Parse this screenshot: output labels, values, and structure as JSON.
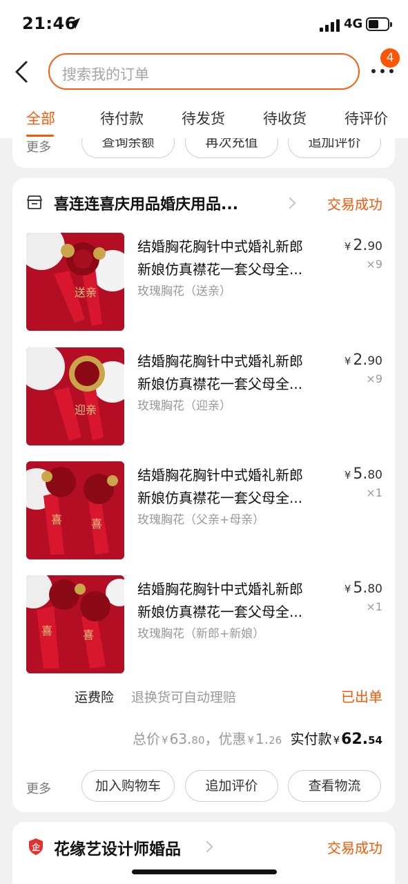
{
  "status_bar": {
    "time": "21:46",
    "network": "4G"
  },
  "header": {
    "search_placeholder": "搜索我的订单",
    "badge_count": "4",
    "tabs": [
      {
        "label": "全部",
        "active": true
      },
      {
        "label": "待付款"
      },
      {
        "label": "待发货"
      },
      {
        "label": "待收货"
      },
      {
        "label": "待评价"
      }
    ]
  },
  "prev_order": {
    "more_label": "更多",
    "actions": [
      "查询余额",
      "再次充值",
      "追加评价"
    ]
  },
  "order": {
    "shop_name": "喜连连喜庆用品婚庆用品...",
    "status": "交易成功",
    "items": [
      {
        "title_line1": "结婚胸花胸针中式婚礼新郎",
        "title_line2": "新娘仿真襟花一套父母全...",
        "sku": "玫瑰胸花（送亲）",
        "price_currency": "¥",
        "price_int": "2.",
        "price_dec": "90",
        "qty": "×9",
        "thumb_text": "送亲"
      },
      {
        "title_line1": "结婚胸花胸针中式婚礼新郎",
        "title_line2": "新娘仿真襟花一套父母全...",
        "sku": "玫瑰胸花（迎亲）",
        "price_currency": "¥",
        "price_int": "2.",
        "price_dec": "90",
        "qty": "×9",
        "thumb_text": "迎亲"
      },
      {
        "title_line1": "结婚胸花胸针中式婚礼新郎",
        "title_line2": "新娘仿真襟花一套父母全...",
        "sku": "玫瑰胸花（父亲+母亲）",
        "price_currency": "¥",
        "price_int": "5.",
        "price_dec": "80",
        "qty": "×1",
        "thumb_text": "喜"
      },
      {
        "title_line1": "结婚胸花胸针中式婚礼新郎",
        "title_line2": "新娘仿真襟花一套父母全...",
        "sku": "玫瑰胸花（新郎+新娘）",
        "price_currency": "¥",
        "price_int": "5.",
        "price_dec": "80",
        "qty": "×1",
        "thumb_text": "喜"
      }
    ],
    "freight_label": "运费险",
    "freight_desc": "退换货可自动理赔",
    "freight_status": "已出单",
    "totals": {
      "total_label": "总价",
      "total_int": "63.",
      "total_dec": "80",
      "discount_label": "，优惠",
      "discount_int": "1.",
      "discount_dec": "26",
      "paid_label": "实付款",
      "paid_int": "62.",
      "paid_dec": "54",
      "currency": "¥"
    },
    "more_label": "更多",
    "actions": [
      "加入购物车",
      "追加评价",
      "查看物流"
    ]
  },
  "next_order": {
    "shop_name": "花缘艺设计师婚品",
    "status": "交易成功"
  },
  "colors": {
    "accent": "#ff5500",
    "product_red": "#c8102e"
  }
}
